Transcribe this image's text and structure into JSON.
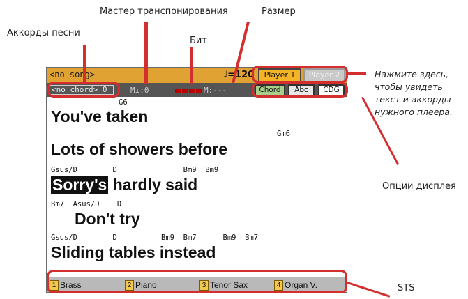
{
  "annotations": {
    "song_chords": "Аккорды песни",
    "transpose_master": "Мастер транспонирования",
    "beat": "Бит",
    "measure": "Размер",
    "press_here": [
      "Нажмите здесь,",
      "чтобы увидеть",
      "текст и аккорды",
      "нужного плеера."
    ],
    "display_options": "Опции дисплея",
    "sts": "STS"
  },
  "screen": {
    "song": "<no song>",
    "tempo": "♩=120",
    "player1": "Player 1",
    "player2": "Player 2",
    "chord_display": "<no chord> 0",
    "transpose": "Mı:0",
    "measure_readout": "M:---",
    "options": [
      "Chord",
      "Abc",
      "CDG"
    ],
    "lines": [
      {
        "chords": "G6",
        "lyric": "You've taken"
      },
      {
        "chords": "Gm6",
        "lyric": "Lots of showers before"
      },
      {
        "chords": "Gsus/D        D               Bm9  Bm9",
        "lyric_highlight": "Sorry's",
        "lyric_rest": " hardly said"
      },
      {
        "chords": "Bm7  Asus/D    D",
        "lyric": "Don't try"
      },
      {
        "chords": "Gsus/D        D          Bm9  Bm7      Bm9  Bm7",
        "lyric": "Sliding tables instead"
      }
    ],
    "sts": [
      {
        "num": "1",
        "label": "Brass"
      },
      {
        "num": "2",
        "label": "Piano"
      },
      {
        "num": "3",
        "label": "Tenor Sax"
      },
      {
        "num": "4",
        "label": "Organ V."
      }
    ]
  }
}
